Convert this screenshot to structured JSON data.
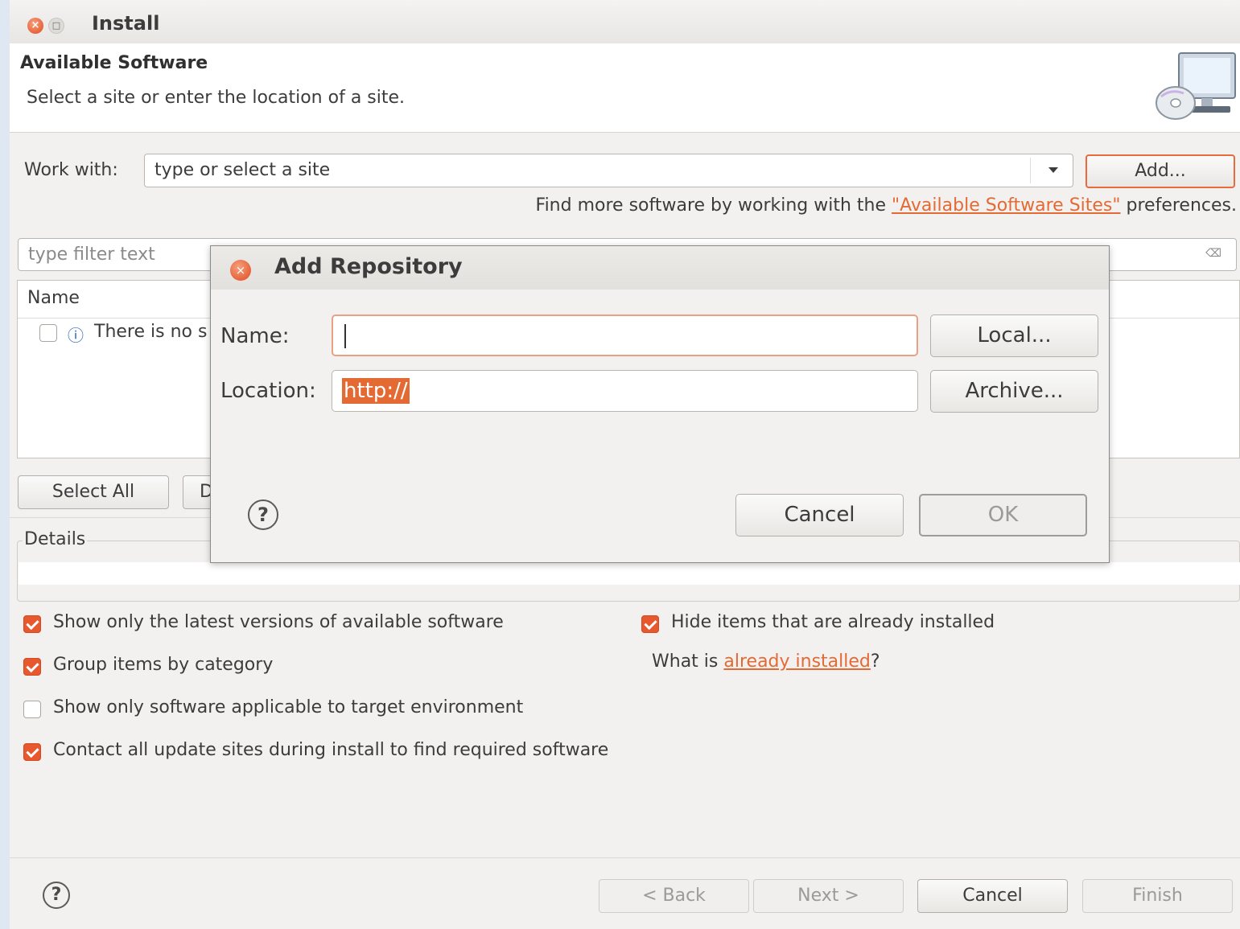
{
  "window": {
    "title": "Install",
    "close_glyph": "×",
    "maximize_glyph": "□"
  },
  "banner": {
    "title": "Available Software",
    "description": "Select a site or enter the location of a site.",
    "icon": "monitor-cd-icon"
  },
  "work_with": {
    "label": "Work with:",
    "placeholder": "type or select a site",
    "add_label": "Add..."
  },
  "find_more": {
    "prefix": "Find more software by working with the ",
    "link": "\"Available Software Sites\"",
    "suffix": " preferences."
  },
  "filter": {
    "placeholder": "type filter text",
    "clear_glyph": "⌫"
  },
  "tree": {
    "column_name": "Name",
    "info_glyph": "ⓘ",
    "row_text": "There is no s"
  },
  "selection_buttons": {
    "select_all": "Select All",
    "deselect_partial": "D"
  },
  "details": {
    "label": "Details"
  },
  "options": {
    "show_latest": {
      "label": "Show only the latest versions of available software",
      "checked": true
    },
    "group_by_category": {
      "label": "Group items by category",
      "checked": true
    },
    "target_env": {
      "label": "Show only software applicable to target environment",
      "checked": false
    },
    "contact_sites": {
      "label": "Contact all update sites during install to find required software",
      "checked": true
    },
    "hide_installed": {
      "label": "Hide items that are already installed",
      "checked": true
    },
    "what_is_prefix": "What is ",
    "what_is_link": "already installed",
    "what_is_suffix": "?"
  },
  "footer": {
    "help_glyph": "?",
    "back": "< Back",
    "next": "Next >",
    "cancel": "Cancel",
    "finish": "Finish"
  },
  "dialog": {
    "title": "Add Repository",
    "close_glyph": "×",
    "name_label": "Name:",
    "name_value": "",
    "location_label": "Location:",
    "location_value": "http://",
    "local_label": "Local...",
    "archive_label": "Archive...",
    "help_glyph": "?",
    "cancel_label": "Cancel",
    "ok_label": "OK"
  },
  "colors": {
    "accent": "#e46a34",
    "checkbox_on": "#e7582e",
    "window_bg": "#f2f1f0"
  }
}
